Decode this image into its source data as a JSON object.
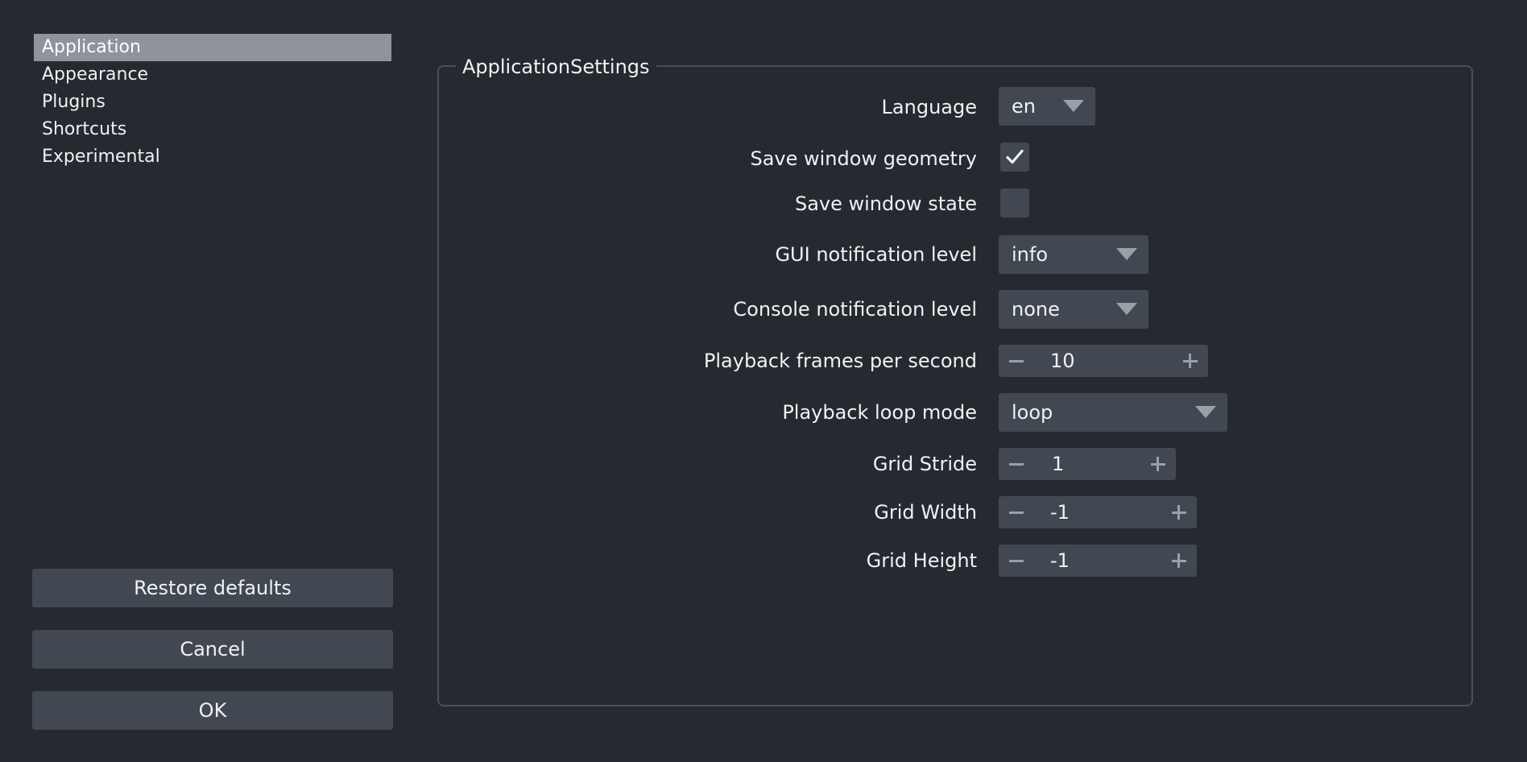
{
  "sidebar": {
    "items": [
      {
        "label": "Application",
        "selected": true
      },
      {
        "label": "Appearance"
      },
      {
        "label": "Plugins"
      },
      {
        "label": "Shortcuts"
      },
      {
        "label": "Experimental"
      }
    ]
  },
  "buttons": {
    "restore_defaults": "Restore defaults",
    "cancel": "Cancel",
    "ok": "OK"
  },
  "settings": {
    "group_title": "ApplicationSettings",
    "language": {
      "label": "Language",
      "value": "en"
    },
    "save_window_geometry": {
      "label": "Save window geometry",
      "checked": true
    },
    "save_window_state": {
      "label": "Save window state",
      "checked": false
    },
    "gui_notification_level": {
      "label": "GUI notification level",
      "value": "info"
    },
    "console_notification_level": {
      "label": "Console notification level",
      "value": "none"
    },
    "playback_fps": {
      "label": "Playback frames per second",
      "value": "10"
    },
    "playback_loop_mode": {
      "label": "Playback loop mode",
      "value": "loop"
    },
    "grid_stride": {
      "label": "Grid Stride",
      "value": "1"
    },
    "grid_width": {
      "label": "Grid Width",
      "value": "-1"
    },
    "grid_height": {
      "label": "Grid Height",
      "value": "-1"
    }
  },
  "colors": {
    "background": "#262930",
    "control": "#414851",
    "selected": "#8f939a",
    "text": "#f0f1f2",
    "icon": "#9aa0a8"
  },
  "icons": {
    "checkmark": "checkmark-icon",
    "dropdown": "chevron-down-icon",
    "decrement": "minus-icon",
    "increment": "plus-icon"
  }
}
